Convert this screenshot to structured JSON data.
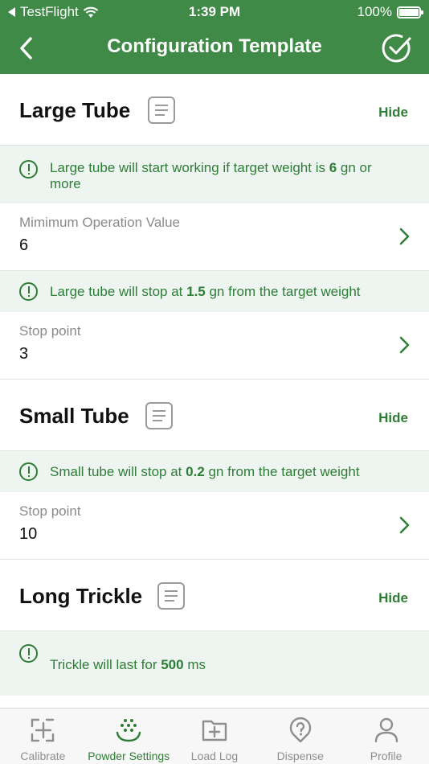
{
  "status_bar": {
    "carrier": "TestFlight",
    "time": "1:39 PM",
    "battery": "100%"
  },
  "nav": {
    "title": "Configuration Template"
  },
  "sections": [
    {
      "title": "Large Tube",
      "hide_label": "Hide"
    },
    {
      "title": "Small Tube",
      "hide_label": "Hide"
    },
    {
      "title": "Long Trickle",
      "hide_label": "Hide"
    }
  ],
  "large_tube": {
    "info_start": {
      "pre": "Large tube will start working if target weight is ",
      "value": "6",
      "post": " gn or more"
    },
    "min_operation": {
      "label": "Mimimum Operation Value",
      "value": "6"
    },
    "info_stop": {
      "pre": "Large tube will stop at ",
      "value": "1.5",
      "post": " gn from the target weight"
    },
    "stop_point": {
      "label": "Stop point",
      "value": "3"
    }
  },
  "small_tube": {
    "info_stop": {
      "pre": "Small tube will stop at ",
      "value": "0.2",
      "post": " gn from the target weight"
    },
    "stop_point": {
      "label": "Stop point",
      "value": "10"
    }
  },
  "long_trickle": {
    "info": {
      "pre": "Trickle will last for ",
      "value": "500",
      "post": " ms"
    }
  },
  "tabs": [
    {
      "label": "Calibrate",
      "icon": "calibrate-icon",
      "active": false
    },
    {
      "label": "Powder Settings",
      "icon": "powder-settings-icon",
      "active": true
    },
    {
      "label": "Load Log",
      "icon": "load-log-icon",
      "active": false
    },
    {
      "label": "Dispense",
      "icon": "dispense-icon",
      "active": false
    },
    {
      "label": "Profile",
      "icon": "profile-icon",
      "active": false
    }
  ],
  "colors": {
    "brand_green": "#3f8a46",
    "accent_green": "#2e7d36",
    "info_background": "#eef5f1"
  }
}
